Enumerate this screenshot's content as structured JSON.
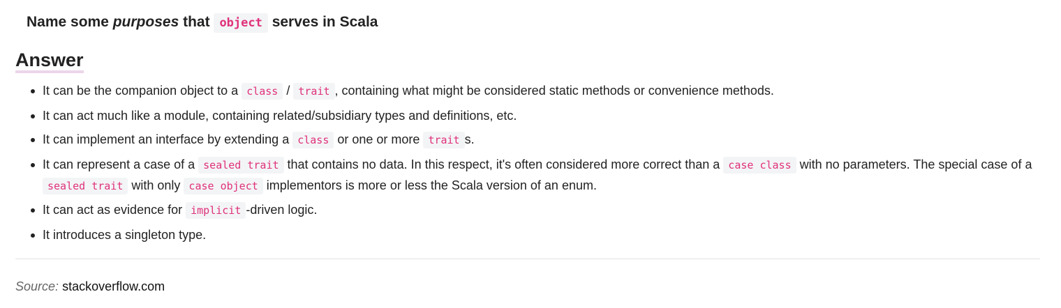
{
  "question": {
    "prefix": "Name some ",
    "emphasis": "purposes",
    "middle": " that ",
    "code": "object",
    "suffix": " serves in Scala"
  },
  "answer_heading": "Answer",
  "answers": {
    "item1": {
      "t1": "It can be the companion object to a ",
      "c1": "class",
      "t2": " / ",
      "c2": "trait",
      "t3": ", containing what might be considered static methods or convenience methods."
    },
    "item2": {
      "t1": "It can act much like a module, containing related/subsidiary types and definitions, etc."
    },
    "item3": {
      "t1": "It can implement an interface by extending a ",
      "c1": "class",
      "t2": " or one or more ",
      "c2": "trait",
      "t3": "s."
    },
    "item4": {
      "t1": "It can represent a case of a ",
      "c1": "sealed trait",
      "t2": " that contains no data. In this respect, it's often considered more correct than a ",
      "c2": "case class",
      "t3": " with no parameters. The special case of a ",
      "c3": "sealed trait",
      "t4": " with only ",
      "c4": "case object",
      "t5": " implementors is more or less the Scala version of an enum."
    },
    "item5": {
      "t1": "It can act as evidence for ",
      "c1": "implicit",
      "t2": "-driven logic."
    },
    "item6": {
      "t1": "It introduces a singleton type."
    }
  },
  "source": {
    "label": "Source:",
    "link": "stackoverflow.com"
  },
  "colors": {
    "code_text": "#e0317a",
    "code_background": "#f3f4f6",
    "heading_underline": "#ecd5ea",
    "divider": "#e3e3e3"
  }
}
